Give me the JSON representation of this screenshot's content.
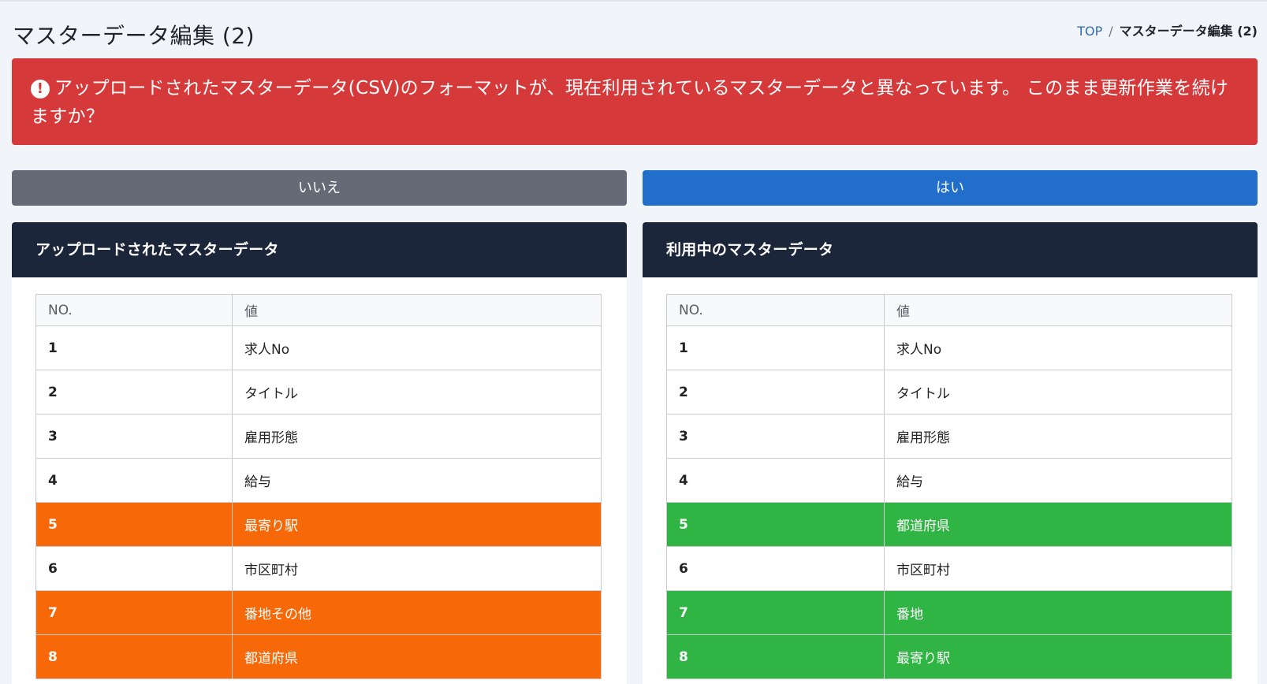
{
  "header": {
    "title": "マスターデータ編集 (2)",
    "breadcrumb": {
      "home": "TOP",
      "separator": "/",
      "current": "マスターデータ編集 (2)"
    }
  },
  "alert": {
    "icon": "!",
    "message": "アップロードされたマスターデータ(CSV)のフォーマットが、現在利用されているマスターデータと異なっています。 このまま更新作業を続けますか？"
  },
  "buttons": {
    "no_label": "いいえ",
    "yes_label": "はい"
  },
  "colors": {
    "alert": "#d6393a",
    "button_no": "#646b76",
    "button_yes": "#216fcb",
    "panel_header": "#1c263b",
    "highlight_uploaded": "#f76808",
    "highlight_current": "#30b545"
  },
  "uploaded": {
    "title": "アップロードされたマスターデータ",
    "columns": [
      "NO.",
      "値"
    ],
    "rows": [
      {
        "no": "1",
        "value": "求人No",
        "highlight": false
      },
      {
        "no": "2",
        "value": "タイトル",
        "highlight": false
      },
      {
        "no": "3",
        "value": "雇用形態",
        "highlight": false
      },
      {
        "no": "4",
        "value": "給与",
        "highlight": false
      },
      {
        "no": "5",
        "value": "最寄り駅",
        "highlight": true
      },
      {
        "no": "6",
        "value": "市区町村",
        "highlight": false
      },
      {
        "no": "7",
        "value": "番地その他",
        "highlight": true
      },
      {
        "no": "8",
        "value": "都道府県",
        "highlight": true
      }
    ]
  },
  "current": {
    "title": "利用中のマスターデータ",
    "columns": [
      "NO.",
      "値"
    ],
    "rows": [
      {
        "no": "1",
        "value": "求人No",
        "highlight": false
      },
      {
        "no": "2",
        "value": "タイトル",
        "highlight": false
      },
      {
        "no": "3",
        "value": "雇用形態",
        "highlight": false
      },
      {
        "no": "4",
        "value": "給与",
        "highlight": false
      },
      {
        "no": "5",
        "value": "都道府県",
        "highlight": true
      },
      {
        "no": "6",
        "value": "市区町村",
        "highlight": false
      },
      {
        "no": "7",
        "value": "番地",
        "highlight": true
      },
      {
        "no": "8",
        "value": "最寄り駅",
        "highlight": true
      }
    ]
  }
}
